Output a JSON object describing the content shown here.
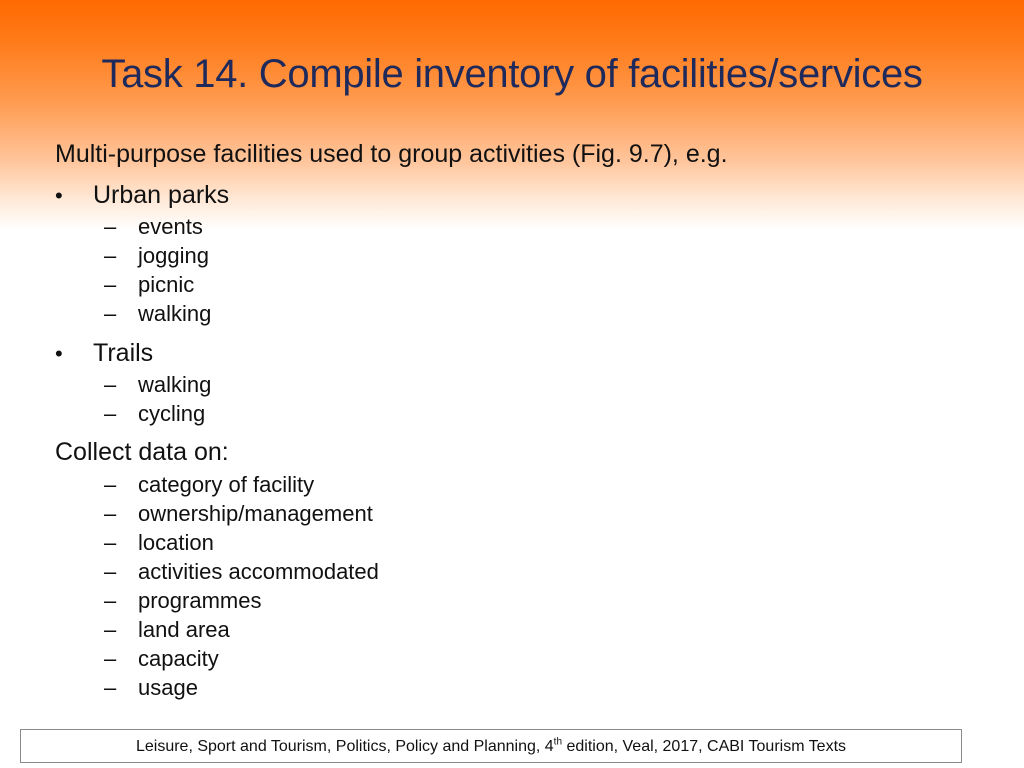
{
  "title": "Task 14. Compile inventory of facilities/services",
  "intro": "Multi-purpose facilities used to group activities (Fig. 9.7), e.g.",
  "bullet_symbol": "•",
  "dash_symbol": "–",
  "groups": [
    {
      "label": "Urban parks",
      "items": [
        "events",
        "jogging",
        "picnic",
        "walking"
      ]
    },
    {
      "label": "Trails",
      "items": [
        "walking",
        "cycling"
      ]
    }
  ],
  "collect": {
    "label": "Collect data on:",
    "items": [
      "category of facility",
      "ownership/management",
      "location",
      "activities accommodated",
      "programmes",
      "land area",
      "capacity",
      "usage"
    ]
  },
  "footer": {
    "before_sup": "Leisure, Sport and Tourism, Politics, Policy and Planning, 4",
    "sup": "th",
    "after_sup": " edition, Veal, 2017, CABI Tourism Texts"
  },
  "colors": {
    "title": "#1f2a5c",
    "gradient_top": "#ff6a00",
    "background": "#ffffff"
  }
}
